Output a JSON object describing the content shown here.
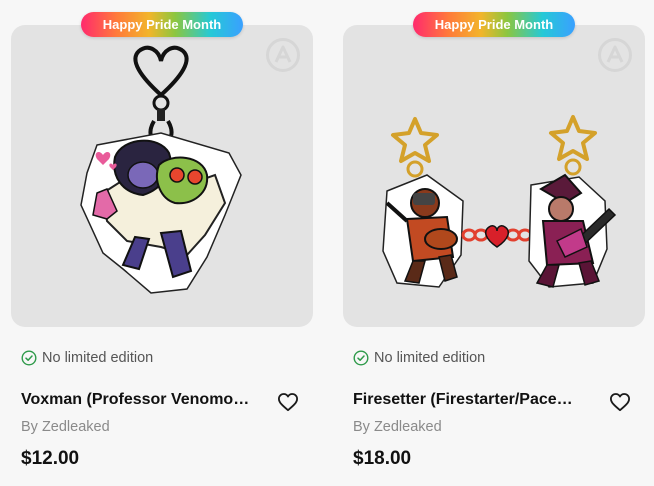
{
  "products": [
    {
      "badge": "Happy Pride Month",
      "image_icon": "brand-logo-icon",
      "edition": "No limited edition",
      "title": "Voxman (Professor Venomous) Acrylic Charm",
      "author": "By Zedleaked",
      "price": "$12.00",
      "favorite_icon": "heart-icon"
    },
    {
      "badge": "Happy Pride Month",
      "image_icon": "brand-logo-icon",
      "edition": "No limited edition",
      "title": "Firesetter (Firestarter/Pacemaker) Acrylic Charm",
      "author": "By Zedleaked",
      "price": "$18.00",
      "favorite_icon": "heart-icon"
    }
  ],
  "colors": {
    "check": "#2e9a4a",
    "card_bg": "#e3e3e3",
    "page_bg": "#f7f7f7"
  }
}
